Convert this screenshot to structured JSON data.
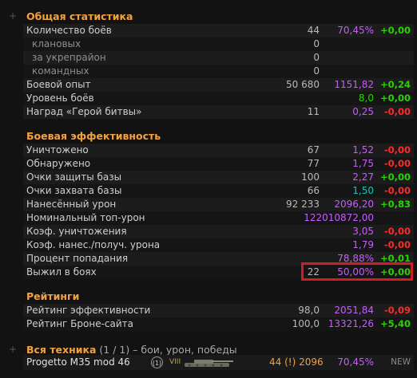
{
  "sections": {
    "general": {
      "title": "Общая статистика",
      "rows": [
        {
          "label": "Количество боёв",
          "count": "44",
          "value": "70,45%",
          "value_color": "purple",
          "delta": "+0,00",
          "delta_sign": "pos"
        },
        {
          "label": "клановых",
          "count": "0",
          "value": "",
          "delta": "",
          "sub": true
        },
        {
          "label": "за укрепрайон",
          "count": "0",
          "value": "",
          "delta": "",
          "sub": true
        },
        {
          "label": "командных",
          "count": "0",
          "value": "",
          "delta": "",
          "sub": true
        },
        {
          "label": "Боевой опыт",
          "count": "50 680",
          "value": "1151,82",
          "value_color": "purple",
          "delta": "+0,24",
          "delta_sign": "pos"
        },
        {
          "label": "Уровень боёв",
          "count": "",
          "value": "8,0",
          "value_color": "green",
          "delta": "+0,00",
          "delta_sign": "pos"
        },
        {
          "label": "Наград «Герой битвы»",
          "count": "11",
          "value": "0,25",
          "value_color": "purple",
          "delta": "-0,00",
          "delta_sign": "neg"
        }
      ]
    },
    "combat": {
      "title": "Боевая эффективность",
      "rows": [
        {
          "label": "Уничтожено",
          "count": "67",
          "value": "1,52",
          "value_color": "purple",
          "delta": "-0,00",
          "delta_sign": "neg"
        },
        {
          "label": "Обнаружено",
          "count": "77",
          "value": "1,75",
          "value_color": "purple",
          "delta": "-0,00",
          "delta_sign": "neg"
        },
        {
          "label": "Очки защиты базы",
          "count": "100",
          "value": "2,27",
          "value_color": "purple",
          "delta": "+0,00",
          "delta_sign": "pos"
        },
        {
          "label": "Очки захвата базы",
          "count": "66",
          "value": "1,50",
          "value_color": "teal",
          "delta": "-0,00",
          "delta_sign": "neg"
        },
        {
          "label": "Нанесённый урон",
          "count": "92 233",
          "value": "2096,20",
          "value_color": "purple",
          "delta": "+0,83",
          "delta_sign": "pos"
        },
        {
          "label": "Номинальный топ-урон",
          "count": "",
          "value": "122010872,00",
          "value_color": "purple",
          "delta": "",
          "delta_sign": "pos"
        },
        {
          "label": "Коэф. уничтожения",
          "count": "",
          "value": "3,05",
          "value_color": "purple",
          "delta": "-0,00",
          "delta_sign": "neg"
        },
        {
          "label": "Коэф. нанес./получ. урона",
          "count": "",
          "value": "1,79",
          "value_color": "purple",
          "delta": "-0,00",
          "delta_sign": "neg"
        },
        {
          "label": "Процент попадания",
          "count": "",
          "value": "78,88%",
          "value_color": "purple",
          "delta": "+0,01",
          "delta_sign": "pos"
        },
        {
          "label": "Выжил в боях",
          "count": "22",
          "value": "50,00%",
          "value_color": "purple",
          "delta": "+0,00",
          "delta_sign": "pos"
        }
      ]
    },
    "ratings": {
      "title": "Рейтинги",
      "rows": [
        {
          "label": "Рейтинг эффективности",
          "count": "98,0",
          "value": "2051,84",
          "value_color": "purple",
          "delta": "-0,09",
          "delta_sign": "neg"
        },
        {
          "label": "Рейтинг Броне-сайта",
          "count": "100,0",
          "value": "13321,26",
          "value_color": "purple",
          "delta": "+5,40",
          "delta_sign": "pos"
        }
      ]
    }
  },
  "vehicles": {
    "title": "Вся техника",
    "subtitle": " (1 / 1) – бои, урон, победы",
    "items": [
      {
        "name": "Progetto M35 mod 46",
        "tier_badge": "(1)",
        "tier_roman": "VIII",
        "battles": "44 (!) 2096",
        "winrate": "70,45%",
        "badge": "NEW",
        "tank_icon": "tank-icon"
      }
    ]
  },
  "plus_glyph": "+",
  "colors": {
    "accent": "#f4a23d",
    "purple": "#c75cff",
    "green": "#27d400",
    "teal": "#18c7b6",
    "negative": "#ff2a2a",
    "highlight": "#d21c24"
  }
}
